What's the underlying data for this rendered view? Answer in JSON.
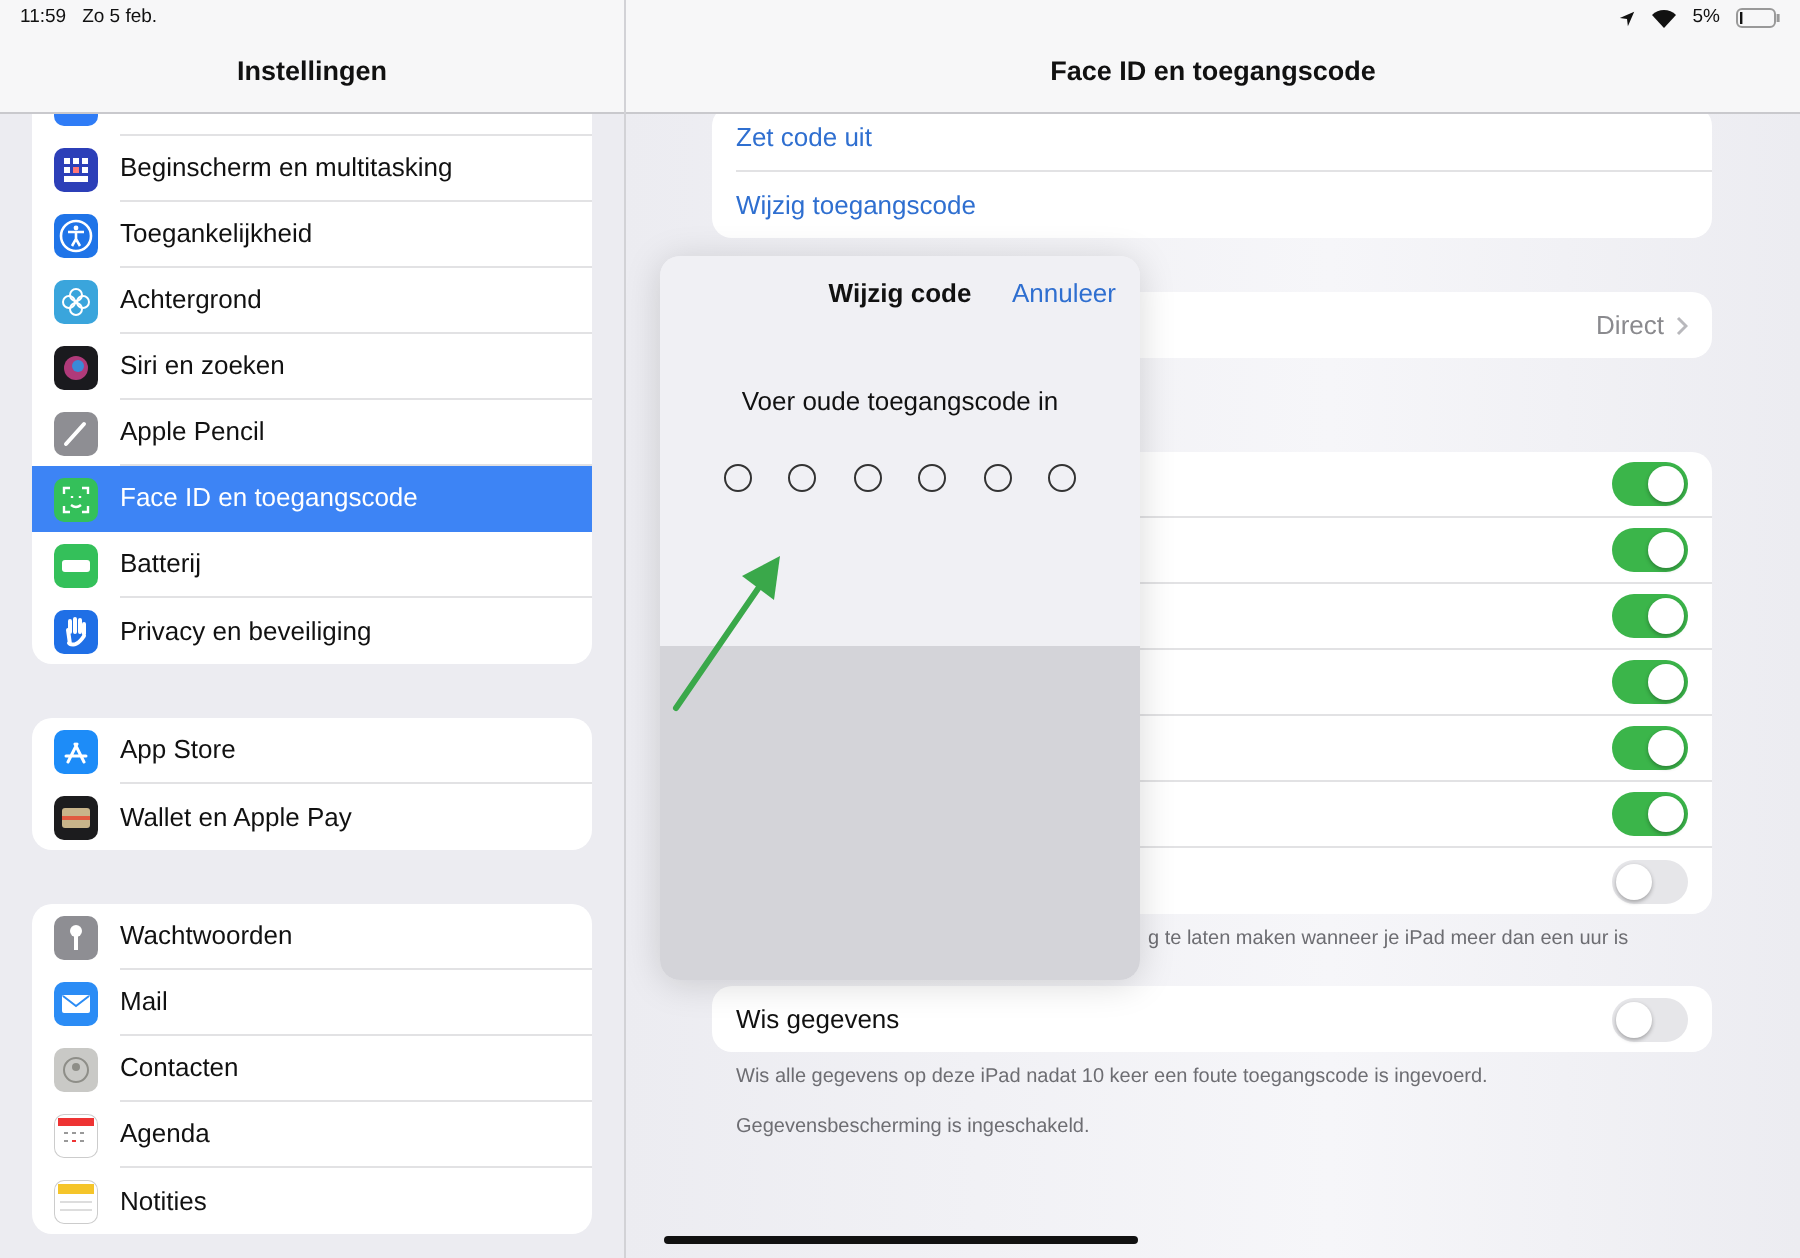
{
  "status_bar": {
    "time": "11:59",
    "date": "Zo 5 feb.",
    "battery": "5%"
  },
  "sidebar": {
    "title": "Instellingen",
    "groups": [
      {
        "items": [
          {
            "kind": "display",
            "selected": false
          },
          {
            "kind": "grid",
            "label": "Beginscherm en multitasking",
            "selected": false
          },
          {
            "kind": "accessibility",
            "label": "Toegankelijkheid",
            "selected": false
          },
          {
            "kind": "flower",
            "label": "Achtergrond",
            "selected": false
          },
          {
            "kind": "siri",
            "label": "Siri en zoeken",
            "selected": false
          },
          {
            "kind": "pencil",
            "label": "Apple Pencil",
            "selected": false
          },
          {
            "kind": "face",
            "label": "Face ID en toegangscode",
            "selected": true
          },
          {
            "kind": "battery",
            "label": "Batterij",
            "selected": false
          },
          {
            "kind": "hand",
            "label": "Privacy en beveiliging",
            "selected": false
          }
        ]
      },
      {
        "items": [
          {
            "kind": "store",
            "label": "App Store",
            "selected": false
          },
          {
            "kind": "wallet",
            "label": "Wallet en Apple Pay",
            "selected": false
          }
        ]
      },
      {
        "items": [
          {
            "kind": "key",
            "label": "Wachtwoorden",
            "selected": false
          },
          {
            "kind": "mail",
            "label": "Mail",
            "selected": false
          },
          {
            "kind": "contacts",
            "label": "Contacten",
            "selected": false
          },
          {
            "kind": "calendar",
            "label": "Agenda",
            "selected": false
          },
          {
            "kind": "notes",
            "label": "Notities",
            "selected": false
          }
        ]
      }
    ]
  },
  "detail": {
    "title": "Face ID en toegangscode",
    "sections": [
      {
        "rows": [
          {
            "kind": "link",
            "label": "Zet code uit"
          },
          {
            "kind": "link",
            "label": "Wijzig toegangscode"
          }
        ]
      },
      {
        "rows": [
          {
            "kind": "value",
            "value": "Direct"
          }
        ]
      },
      {
        "rows": [
          {
            "kind": "toggle",
            "on": true
          },
          {
            "kind": "toggle",
            "on": true
          },
          {
            "kind": "toggle",
            "on": true
          },
          {
            "kind": "toggle",
            "on": true
          },
          {
            "kind": "toggle",
            "on": true
          },
          {
            "kind": "toggle",
            "on": true
          },
          {
            "kind": "toggle",
            "on": false
          }
        ],
        "footers": [
          "g te laten maken wanneer je iPad meer dan een uur is"
        ]
      },
      {
        "rows": [
          {
            "kind": "toggle",
            "label": "Wis gegevens",
            "on": false
          }
        ],
        "footers": [
          "Wis alle gegevens op deze iPad nadat 10 keer een foute toegangscode is ingevoerd.",
          "Gegevensbescherming is ingeschakeld."
        ]
      }
    ]
  },
  "modal": {
    "title": "Wijzig code",
    "cancel": "Annuleer",
    "prompt": "Voer oude toegangscode in",
    "digits": [
      {
        "filled": false
      },
      {
        "filled": false
      },
      {
        "filled": false
      },
      {
        "filled": false
      },
      {
        "filled": false
      },
      {
        "filled": false
      }
    ]
  }
}
